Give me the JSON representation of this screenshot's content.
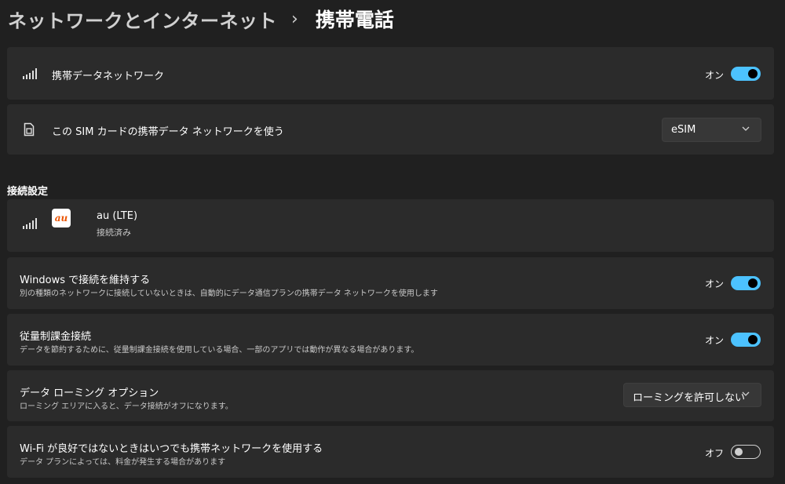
{
  "header": {
    "parent": "ネットワークとインターネット",
    "separator": "›",
    "current": "携帯電話"
  },
  "cellular_network": {
    "label": "携帯データネットワーク",
    "state": "オン",
    "on": true,
    "icon": "cellular-signal-icon"
  },
  "sim_select": {
    "label": "この SIM カードの携帯データ ネットワークを使う",
    "value": "eSIM",
    "icon": "sim-card-icon"
  },
  "connection_settings": {
    "heading": "接続設定",
    "carrier": {
      "name": "au (LTE)",
      "status": "接続済み",
      "logo_text": "au",
      "logo_color": "#eb5505"
    }
  },
  "settings": [
    {
      "label": "Windows で接続を維持する",
      "desc": "別の種類のネットワークに接続していないときは、自動的にデータ通信プランの携帯データ ネットワークを使用します",
      "state": "オン",
      "on": true
    },
    {
      "label": "従量制課金接続",
      "desc": "データを節約するために、従量制課金接続を使用している場合、一部のアプリでは動作が異なる場合があります。",
      "state": "オン",
      "on": true
    },
    {
      "label": "データ ローミング オプション",
      "desc": "ローミング エリアに入ると、データ接続がオフになります。",
      "dropdown_value": "ローミングを許可しない"
    },
    {
      "label": "Wi-Fi が良好ではないときはいつでも携帯ネットワークを使用する",
      "desc": "データ プランによっては、料金が発生する場合があります",
      "state": "オフ",
      "on": false
    }
  ],
  "colors": {
    "background": "#202020",
    "card": "#2b2b2b",
    "accent": "#4cc2ff"
  }
}
